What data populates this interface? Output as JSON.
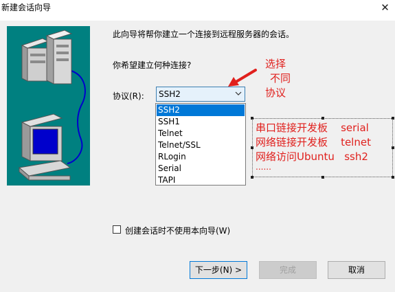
{
  "window": {
    "title": "新建会话向导",
    "close_glyph": "✕"
  },
  "intro": "此向导将帮你建立一个连接到远程服务器的会话。",
  "question": "你希望建立何种连接?",
  "protocol": {
    "label": "协议(R):",
    "selected": "SSH2",
    "options": [
      "SSH2",
      "SSH1",
      "Telnet",
      "Telnet/SSL",
      "RLogin",
      "Serial",
      "TAPI"
    ]
  },
  "annotations": {
    "arrow_note": [
      "选择",
      "不同",
      "协议"
    ],
    "box_lines": [
      "串口链接开发板    serial",
      "网络链接开发板    telnet",
      "网络访问Ubuntu   ssh2",
      "......"
    ],
    "color": "#e0201d"
  },
  "checkbox": {
    "label": "创建会话时不使用本向导(W)",
    "checked": false
  },
  "buttons": {
    "next": "下一步(N) >",
    "finish": "完成",
    "cancel": "取消"
  },
  "colors": {
    "panel": "#008080",
    "accent": "#0078d7"
  }
}
